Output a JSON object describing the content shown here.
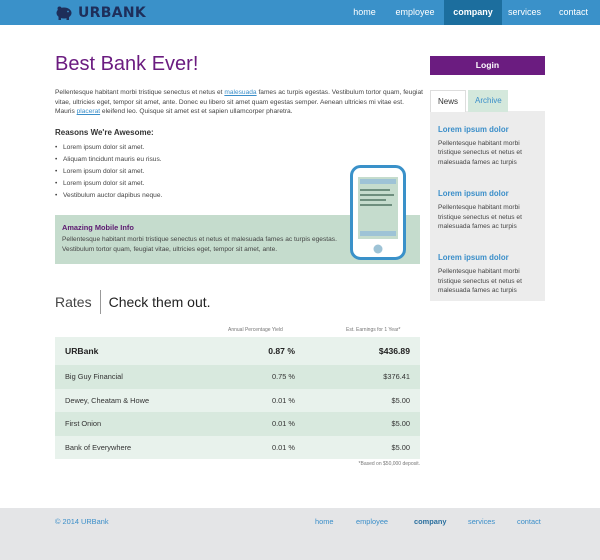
{
  "brand": {
    "name": "URBANK",
    "logo_icon": "piggy-bank-icon"
  },
  "nav": {
    "items": [
      {
        "label": "home"
      },
      {
        "label": "employee"
      },
      {
        "label": "company",
        "active": true
      },
      {
        "label": "services"
      },
      {
        "label": "contact"
      }
    ]
  },
  "main": {
    "title": "Best Bank Ever!",
    "intro": {
      "part1": "Pellentesque habitant morbi tristique senectus et netus et ",
      "link1": "malesuada",
      "part2": " fames ac turpis egestas. Vestibulum tortor quam, feugiat vitae, ultricies eget, tempor sit amet, ante. Donec eu libero sit amet quam egestas semper. Aenean ultricies mi vitae est. Mauris ",
      "link2": "placerat",
      "part3": " eleifend leo. Quisque sit amet est et sapien ullamcorper pharetra."
    },
    "reasons_heading": "Reasons We're Awesome:",
    "reasons": [
      "Lorem ipsum dolor sit amet.",
      "Aliquam tincidunt mauris eu risus.",
      "Lorem ipsum dolor sit amet.",
      "Lorem ipsum dolor sit amet.",
      "Vestibulum auctor dapibus neque."
    ],
    "mobile": {
      "title": "Amazing Mobile Info",
      "text": "Pellentesque habitant morbi tristique senectus et netus et malesuada fames ac turpis egestas. Vestibulum tortor quam, feugiat vitae, ultricies eget, tempor sit amet, ante."
    }
  },
  "rates": {
    "heading_left": "Rates",
    "heading_right": "Check them out.",
    "col_apy": "Annual Percentage Yield",
    "col_earnings": "Est. Earnings for 1 Year*",
    "rows": [
      {
        "name": "URBank",
        "apy": "0.87 %",
        "earnings": "$436.89"
      },
      {
        "name": "Big Guy Financial",
        "apy": "0.75 %",
        "earnings": "$376.41"
      },
      {
        "name": "Dewey, Cheatam & Howe",
        "apy": "0.01 %",
        "earnings": "$5.00"
      },
      {
        "name": "First Onion",
        "apy": "0.01 %",
        "earnings": "$5.00"
      },
      {
        "name": "Bank of Everywhere",
        "apy": "0.01 %",
        "earnings": "$5.00"
      }
    ],
    "footnote": "*Based on $50,000 deposit."
  },
  "sidebar": {
    "login_label": "Login",
    "tabs": [
      {
        "label": "News",
        "active": true
      },
      {
        "label": "Archive"
      }
    ],
    "news": [
      {
        "title": "Lorem ipsum dolor",
        "text": "Pellentesque habitant morbi tristique senectus et netus et malesuada fames ac turpis"
      },
      {
        "title": "Lorem ipsum dolor",
        "text": "Pellentesque habitant morbi tristique senectus et netus et malesuada fames ac turpis"
      },
      {
        "title": "Lorem ipsum dolor",
        "text": "Pellentesque habitant morbi tristique senectus et netus et malesuada fames ac turpis"
      }
    ]
  },
  "footer": {
    "copyright": "© 2014 URBank",
    "nav": [
      {
        "label": "home"
      },
      {
        "label": "employee"
      },
      {
        "label": "company"
      },
      {
        "label": "services"
      },
      {
        "label": "contact"
      }
    ]
  },
  "colors": {
    "header_bg": "#3a91c9",
    "active_nav": "#1c6e9e",
    "brand_purple": "#6b1c80",
    "link_blue": "#3a8ec9",
    "mint": "#c5dccd"
  }
}
